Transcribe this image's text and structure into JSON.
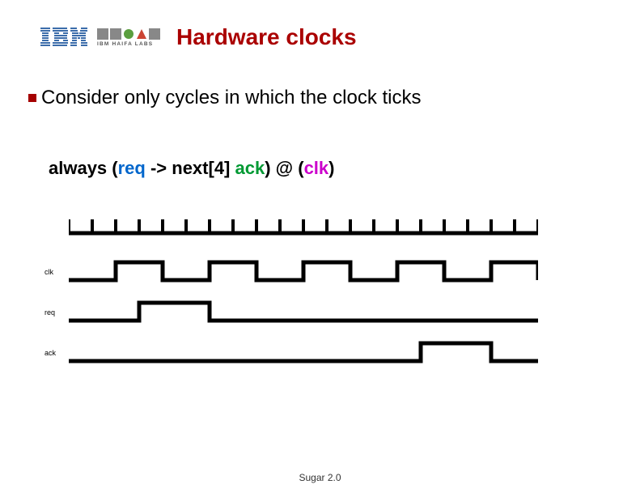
{
  "header": {
    "logo_text": "IBM HAIFA LABS",
    "title": "Hardware clocks"
  },
  "bullet": {
    "text": "Consider only cycles in which the clock ticks"
  },
  "formula": {
    "t1": "always (",
    "req": "req",
    "t2": " -> next[4] ",
    "ack": "ack",
    "t3": ") @ (",
    "clk": "clk",
    "t4": ")"
  },
  "waveforms": {
    "label_clk": "clk",
    "label_req": "req",
    "label_ack": "ack"
  },
  "chart_data": {
    "type": "table",
    "description": "Timing diagram signals over 20 fine-grained time ticks",
    "signals": [
      {
        "name": "fine_ticks",
        "count": 20
      },
      {
        "name": "clk",
        "period_ticks": 4,
        "duty": 0.5,
        "cycles_shown": 5
      },
      {
        "name": "req",
        "edges": [
          [
            0,
            0
          ],
          [
            3,
            1
          ],
          [
            6,
            0
          ],
          [
            20,
            0
          ]
        ]
      },
      {
        "name": "ack",
        "edges": [
          [
            0,
            0
          ],
          [
            15,
            1
          ],
          [
            18,
            0
          ],
          [
            20,
            0
          ]
        ]
      }
    ]
  },
  "footer": {
    "text": "Sugar 2.0"
  }
}
